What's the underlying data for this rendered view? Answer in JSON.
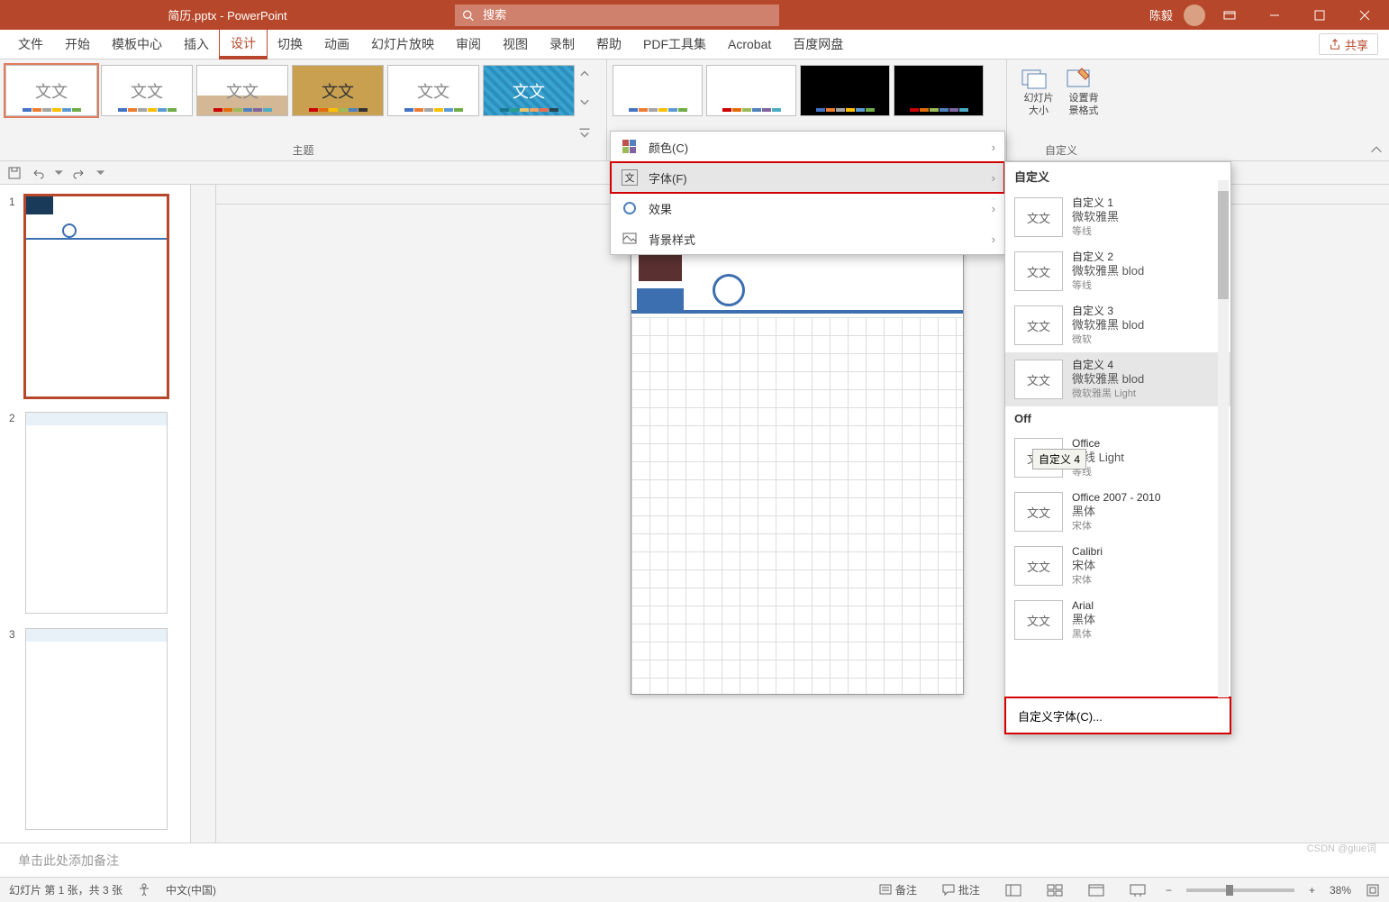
{
  "titlebar": {
    "filename": "简历.pptx",
    "app": "PowerPoint",
    "search_placeholder": "搜索",
    "username": "陈毅"
  },
  "tabs": [
    "文件",
    "开始",
    "模板中心",
    "插入",
    "设计",
    "切换",
    "动画",
    "幻灯片放映",
    "审阅",
    "视图",
    "录制",
    "帮助",
    "PDF工具集",
    "Acrobat",
    "百度网盘"
  ],
  "active_tab": "设计",
  "share_label": "共享",
  "ribbon": {
    "themes_label": "主题",
    "custom_label": "自定义",
    "theme_text": "文文",
    "slide_size": "幻灯片\n大小",
    "bg_format": "设置背\n景格式"
  },
  "variant_menu": {
    "colors": "颜色(C)",
    "fonts": "字体(F)",
    "effects": "效果",
    "bg_styles": "背景样式"
  },
  "font_panel": {
    "section_custom": "自定义",
    "section_office": "Off",
    "tooltip": "自定义 4",
    "items_custom": [
      {
        "name": "自定义 1",
        "major": "微软雅黑",
        "minor": "等线"
      },
      {
        "name": "自定义 2",
        "major": "微软雅黑 blod",
        "minor": "等线"
      },
      {
        "name": "自定义 3",
        "major": "微软雅黑 blod",
        "minor": "微软"
      },
      {
        "name": "自定义 4",
        "major": "微软雅黑 blod",
        "minor": "微软雅黑 Light"
      }
    ],
    "items_office": [
      {
        "name": "Office",
        "major": "等线 Light",
        "minor": "等线"
      },
      {
        "name": "Office 2007 - 2010",
        "major": "黑体",
        "minor": "宋体"
      },
      {
        "name": "Calibri",
        "major": "宋体",
        "minor": "宋体"
      },
      {
        "name": "Arial",
        "major": "黑体",
        "minor": "黑体"
      }
    ],
    "thumb_text": "文文",
    "customize": "自定义字体(C)..."
  },
  "notes_placeholder": "单击此处添加备注",
  "statusbar": {
    "slide_info": "幻灯片 第 1 张，共 3 张",
    "lang": "中文(中国)",
    "notes_btn": "备注",
    "comments_btn": "批注",
    "zoom": "38%"
  },
  "slides": [
    1,
    2,
    3
  ],
  "watermark": "CSDN @glue词"
}
